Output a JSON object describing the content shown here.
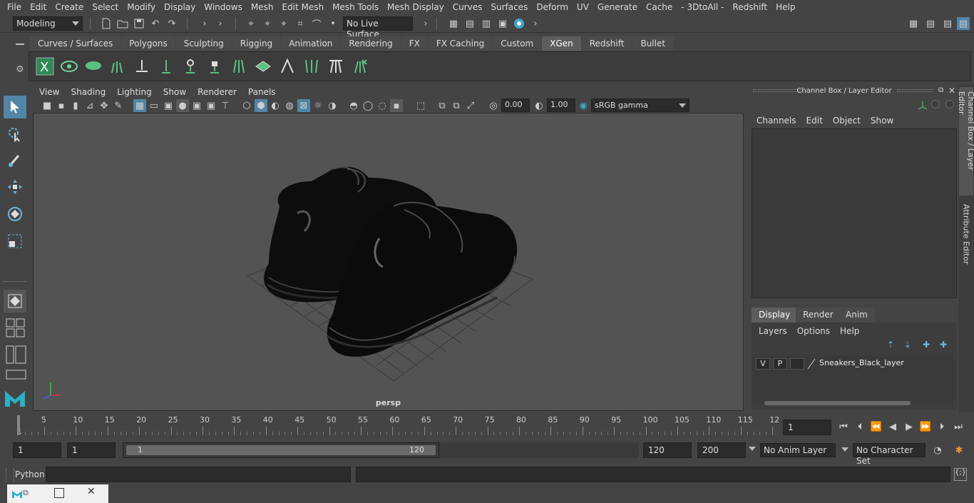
{
  "menus": [
    "File",
    "Edit",
    "Create",
    "Select",
    "Modify",
    "Display",
    "Windows",
    "Mesh",
    "Edit Mesh",
    "Mesh Tools",
    "Mesh Display",
    "Curves",
    "Surfaces",
    "Deform",
    "UV",
    "Generate",
    "Cache",
    "- 3DtoAll -",
    "Redshift",
    "Help"
  ],
  "status": {
    "mode": "Modeling",
    "live_surface": "No Live Surface"
  },
  "shelf_tabs": [
    {
      "label": "Curves / Surfaces"
    },
    {
      "label": "Polygons"
    },
    {
      "label": "Sculpting"
    },
    {
      "label": "Rigging"
    },
    {
      "label": "Animation"
    },
    {
      "label": "Rendering"
    },
    {
      "label": "FX"
    },
    {
      "label": "FX Caching"
    },
    {
      "label": "Custom"
    },
    {
      "label": "XGen"
    },
    {
      "label": "Redshift"
    },
    {
      "label": "Bullet"
    }
  ],
  "active_shelf_tab": "XGen",
  "viewport": {
    "menus": [
      "View",
      "Shading",
      "Lighting",
      "Show",
      "Renderer",
      "Panels"
    ],
    "exposure": "0.00",
    "gamma": "1.00",
    "color_space": "sRGB gamma",
    "camera_label": "persp"
  },
  "channel_box": {
    "title": "Channel Box / Layer Editor",
    "menus": [
      "Channels",
      "Edit",
      "Object",
      "Show"
    ]
  },
  "layer_editor": {
    "tabs": [
      "Display",
      "Render",
      "Anim"
    ],
    "active_tab": "Display",
    "menus": [
      "Layers",
      "Options",
      "Help"
    ],
    "layers": [
      {
        "v": "V",
        "p": "P",
        "name": "Sneakers_Black_layer"
      }
    ]
  },
  "side_tabs": {
    "channel_box": "Channel Box / Layer Editor",
    "attribute_editor": "Attribute Editor"
  },
  "timeline": {
    "ticks": [
      "5",
      "10",
      "15",
      "20",
      "25",
      "30",
      "35",
      "40",
      "45",
      "50",
      "55",
      "60",
      "65",
      "70",
      "75",
      "80",
      "85",
      "90",
      "95",
      "100",
      "105",
      "110",
      "115",
      "12"
    ],
    "start_tick": "1",
    "current_frame": "1"
  },
  "range": {
    "start": "1",
    "playback_start": "1",
    "slider_start": "1",
    "slider_end": "120",
    "playback_end": "120",
    "end": "200",
    "anim_layer": "No Anim Layer",
    "character_set": "No Character Set"
  },
  "command": {
    "label": "Python"
  },
  "colors": {
    "accent": "#5285a6",
    "active_green": "#2f9e6a"
  }
}
